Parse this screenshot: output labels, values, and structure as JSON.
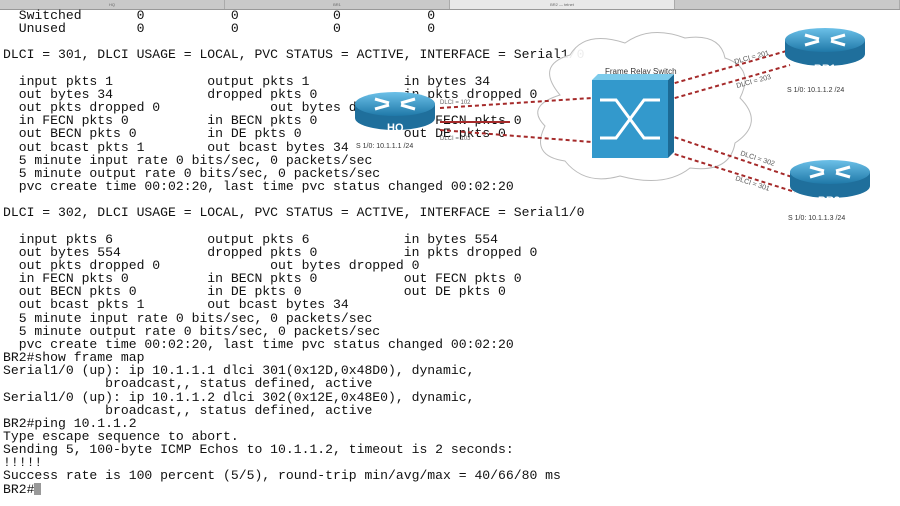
{
  "window": {
    "tabs": [
      "HQ",
      "BR1",
      "BR2 — telnet"
    ],
    "active_tab": 2
  },
  "terminal": {
    "lines": [
      "  Switched       0           0            0           0",
      "  Unused         0           0            0           0",
      "",
      "DLCI = 301, DLCI USAGE = LOCAL, PVC STATUS = ACTIVE, INTERFACE = Serial1/0",
      "",
      "  input pkts 1            output pkts 1            in bytes 34",
      "  out bytes 34            dropped pkts 0           in pkts dropped 0",
      "  out pkts dropped 0              out bytes dropped 0",
      "  in FECN pkts 0          in BECN pkts 0           out FECN pkts 0",
      "  out BECN pkts 0         in DE pkts 0             out DE pkts 0",
      "  out bcast pkts 1        out bcast bytes 34",
      "  5 minute input rate 0 bits/sec, 0 packets/sec",
      "  5 minute output rate 0 bits/sec, 0 packets/sec",
      "  pvc create time 00:02:20, last time pvc status changed 00:02:20",
      "",
      "DLCI = 302, DLCI USAGE = LOCAL, PVC STATUS = ACTIVE, INTERFACE = Serial1/0",
      "",
      "  input pkts 6            output pkts 6            in bytes 554",
      "  out bytes 554           dropped pkts 0           in pkts dropped 0",
      "  out pkts dropped 0              out bytes dropped 0",
      "  in FECN pkts 0          in BECN pkts 0           out FECN pkts 0",
      "  out BECN pkts 0         in DE pkts 0             out DE pkts 0",
      "  out bcast pkts 1        out bcast bytes 34",
      "  5 minute input rate 0 bits/sec, 0 packets/sec",
      "  5 minute output rate 0 bits/sec, 0 packets/sec",
      "  pvc create time 00:02:20, last time pvc status changed 00:02:20",
      "BR2#show frame map",
      "Serial1/0 (up): ip 10.1.1.1 dlci 301(0x12D,0x48D0), dynamic,",
      "             broadcast,, status defined, active",
      "Serial1/0 (up): ip 10.1.1.2 dlci 302(0x12E,0x48E0), dynamic,",
      "             broadcast,, status defined, active",
      "BR2#ping 10.1.1.2",
      "Type escape sequence to abort.",
      "Sending 5, 100-byte ICMP Echos to 10.1.1.2, timeout is 2 seconds:",
      "!!!!!",
      "Success rate is 100 percent (5/5), round-trip min/avg/max = 40/66/80 ms"
    ],
    "prompt": "BR2#"
  },
  "diagram": {
    "switch_label": "Frame Relay Switch",
    "hq": {
      "name": "HQ",
      "ip": "S 1/0: 10.1.1.1 /24",
      "dlci_a": "DLCI = 102",
      "dlci_b": "DLCI = 103"
    },
    "br1": {
      "name": "BR1",
      "ip": "S 1/0: 10.1.1.2 /24",
      "dlci_a": "DLCI = 201",
      "dlci_b": "DLCI = 203"
    },
    "br2": {
      "name": "BR2",
      "ip": "S 1/0: 10.1.1.3 /24",
      "dlci_a": "DLCI = 302",
      "dlci_b": "DLCI = 301"
    },
    "colors": {
      "router": "#2f8fc0",
      "switch": "#3399cc",
      "link": "#a52a2a"
    }
  }
}
